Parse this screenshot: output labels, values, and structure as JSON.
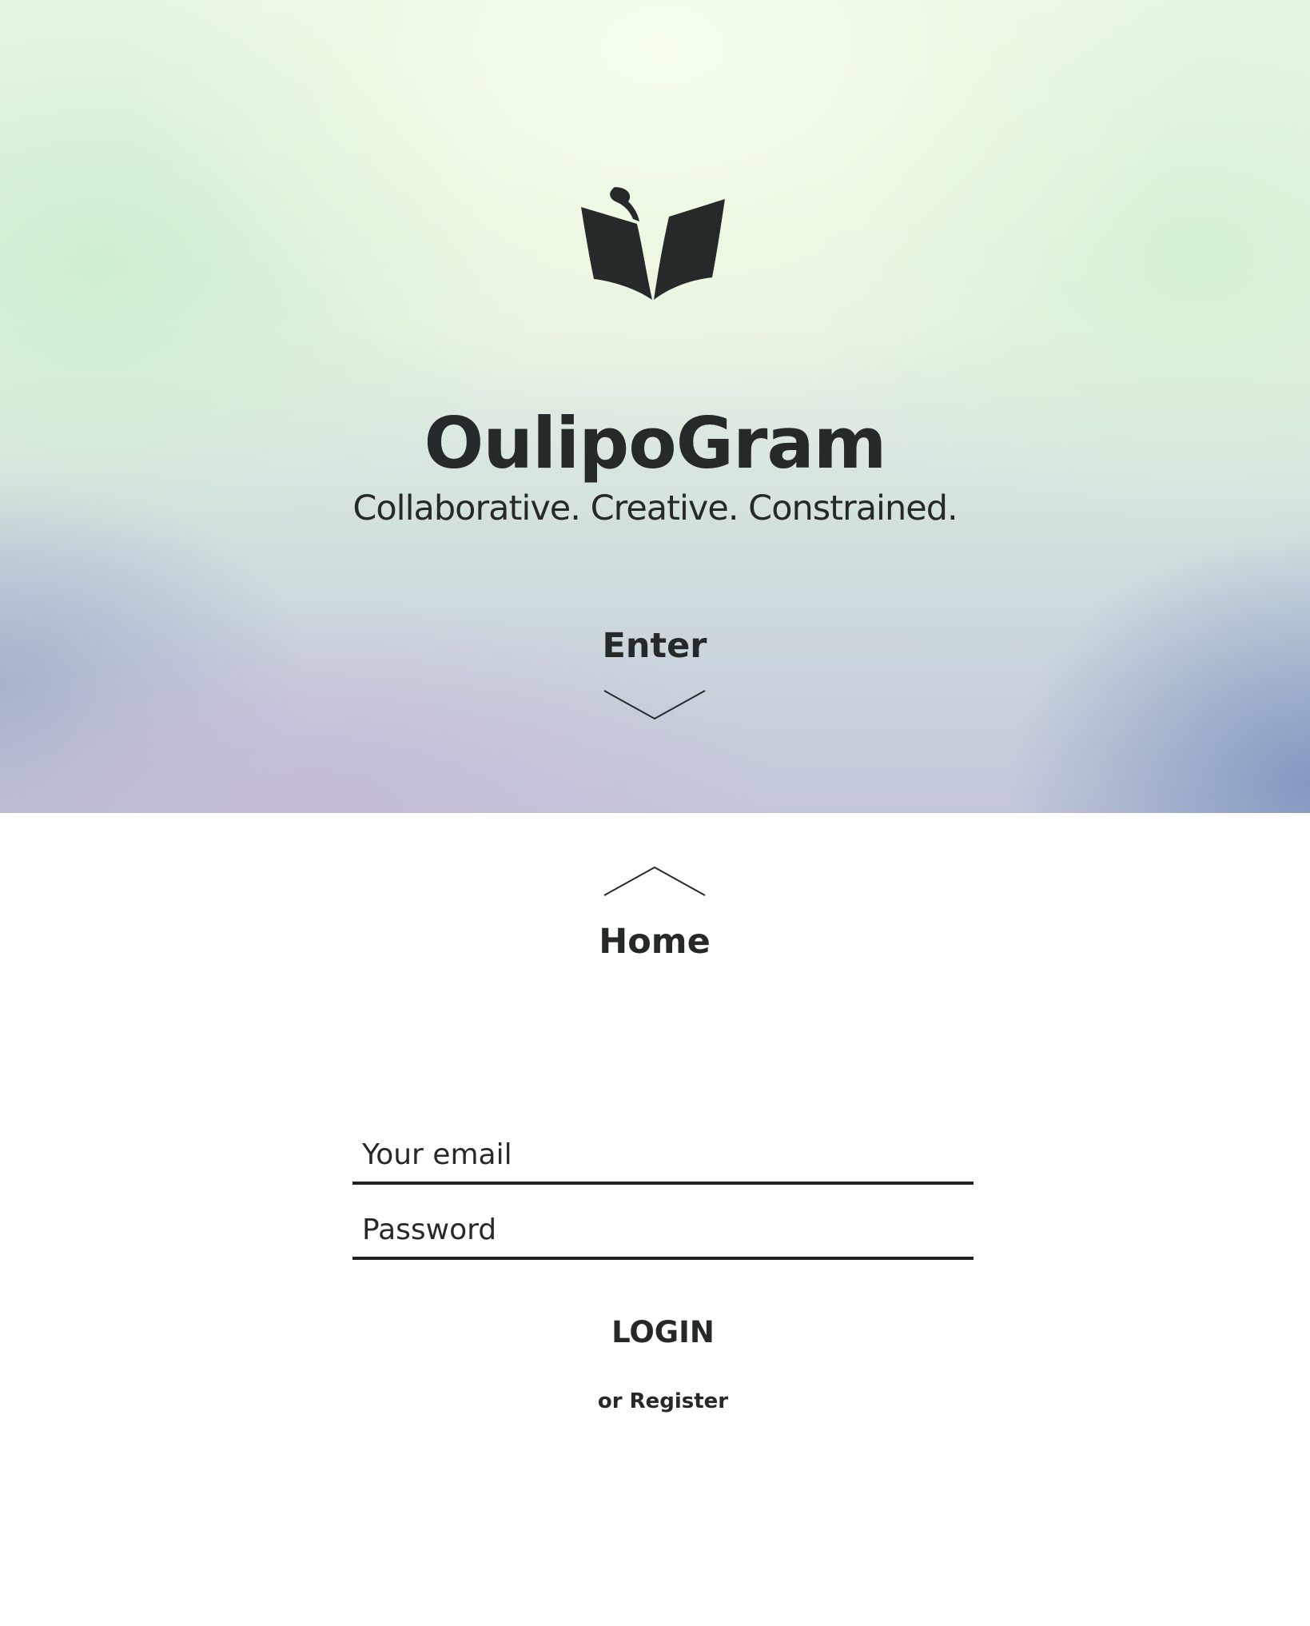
{
  "app": {
    "title": "OulipoGram",
    "tagline": "Collaborative. Creative. Constrained.",
    "logo_icon": "open-book-icon"
  },
  "hero": {
    "enter_label": "Enter",
    "enter_icon": "chevron-down-icon"
  },
  "nav": {
    "home_label": "Home",
    "home_icon": "chevron-up-icon"
  },
  "login_form": {
    "email_placeholder": "Your email",
    "password_placeholder": "Password",
    "login_label": "LOGIN",
    "register_label": "or Register"
  },
  "colors": {
    "text": "#26292a",
    "underline": "#1f2122",
    "background": "#ffffff"
  }
}
